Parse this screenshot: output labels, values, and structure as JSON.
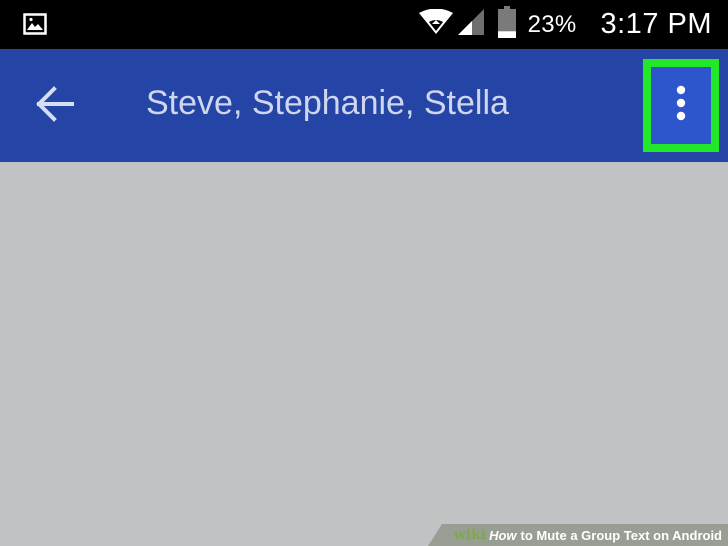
{
  "status_bar": {
    "battery_percent": "23%",
    "time": "3:17 PM",
    "battery_level": 0.23,
    "icons": [
      "gallery-notification-icon",
      "wifi-icon",
      "signal-icon",
      "battery-icon"
    ]
  },
  "app_bar": {
    "title": "Steve, Stephanie, Stella",
    "back_icon": "back-arrow-icon",
    "menu_icon": "more-vert-icon",
    "highlight_color": "#23e82a",
    "background_color": "#2445a6"
  },
  "watermark": {
    "wiki": "wiki",
    "how": "How",
    "rest": "to Mute a Group Text on Android"
  }
}
